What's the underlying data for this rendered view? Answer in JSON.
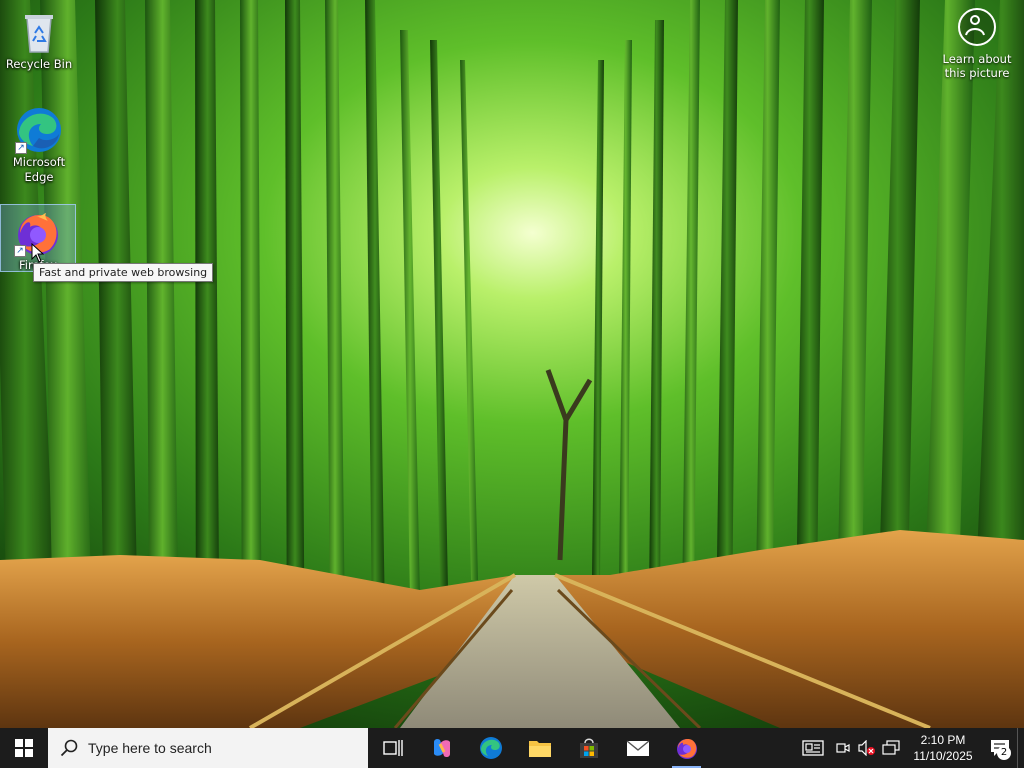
{
  "desktop": {
    "icons": [
      {
        "label": "Recycle Bin",
        "icon": "recycle-bin-icon"
      },
      {
        "label": "Microsoft Edge",
        "icon": "edge-icon"
      },
      {
        "label": "Firefox",
        "icon": "firefox-icon"
      }
    ],
    "learn_widget": {
      "label": "Learn about this picture",
      "icon": "camera-info-icon"
    },
    "tooltip": "Fast and private web browsing"
  },
  "taskbar": {
    "search_placeholder": "Type here to search",
    "pinned": [
      {
        "name": "task-view",
        "icon": "task-view-icon"
      },
      {
        "name": "copilot",
        "icon": "copilot-icon"
      },
      {
        "name": "edge",
        "icon": "edge-icon"
      },
      {
        "name": "file-explorer",
        "icon": "folder-icon"
      },
      {
        "name": "microsoft-store",
        "icon": "store-icon"
      },
      {
        "name": "mail",
        "icon": "mail-icon"
      },
      {
        "name": "firefox",
        "icon": "firefox-icon"
      }
    ],
    "clock": {
      "time": "2:10 PM",
      "date": "11/10/2025"
    },
    "notification_count": "2"
  },
  "colors": {
    "taskbar_bg": "#1c1c1c",
    "search_bg": "#f3f3f3",
    "bamboo_light": "#8fe24a",
    "bamboo_dark": "#1f5a12",
    "grass": "#c8862e"
  }
}
